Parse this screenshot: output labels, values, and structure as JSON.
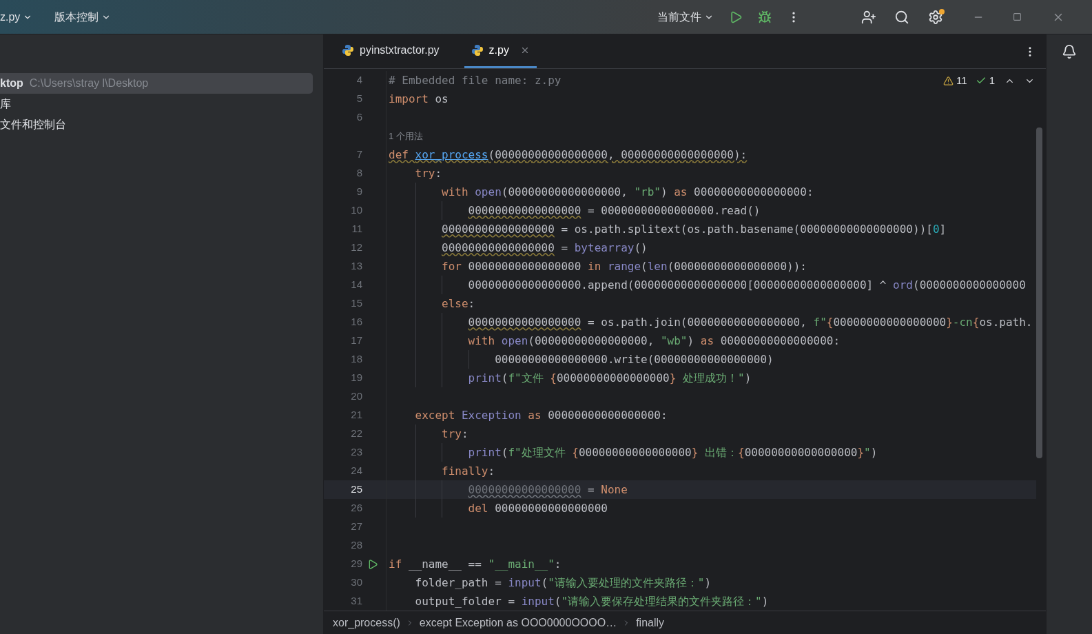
{
  "toolbar": {
    "project": "z.py",
    "vcs": "版本控制",
    "run_config": "当前文件"
  },
  "project_panel": {
    "items": [
      {
        "label": "ktop",
        "path": "C:\\Users\\stray l\\Desktop",
        "selected": true
      },
      {
        "label": "库",
        "selected": false
      },
      {
        "label": "文件和控制台",
        "selected": false
      }
    ]
  },
  "tabs": [
    {
      "label": "pyinstxtractor.py",
      "selected": false
    },
    {
      "label": "z.py",
      "selected": true
    }
  ],
  "inspections": {
    "warnings": "11",
    "passed": "1"
  },
  "lines": [
    {
      "kind": "code",
      "number": "4",
      "current": false,
      "warning": false,
      "run": false,
      "tokens": [
        {
          "kind": "comment",
          "text": "# Embedded file name: z.py"
        }
      ]
    },
    {
      "kind": "code",
      "number": "5",
      "current": false,
      "warning": false,
      "run": false,
      "tokens": [
        {
          "kind": "kw",
          "text": "import"
        },
        {
          "kind": "plain",
          "text": " os"
        }
      ]
    },
    {
      "kind": "code",
      "number": "6",
      "current": false,
      "run": false
    },
    {
      "kind": "hint",
      "text": "1 个用法"
    },
    {
      "kind": "code",
      "number": "7",
      "current": false,
      "warning": true,
      "run": false,
      "tokens": [
        {
          "kind": "kw",
          "text": "def "
        },
        {
          "kind": "fn",
          "text": "xor_process"
        },
        {
          "kind": "plain",
          "text": "(00000000000000000, 00000000000000000):"
        }
      ]
    },
    {
      "kind": "code",
      "number": "8",
      "current": false,
      "warning": false,
      "run": false,
      "tokens": [
        {
          "kind": "kw",
          "text": "    try"
        },
        {
          "kind": "plain",
          "text": ":"
        }
      ]
    },
    {
      "kind": "code",
      "number": "9",
      "current": false,
      "warning": false,
      "run": false,
      "tokens": [
        {
          "kind": "kw",
          "text": "        with "
        },
        {
          "kind": "builtin",
          "text": "open"
        },
        {
          "kind": "plain",
          "text": "(00000000000000000, "
        },
        {
          "kind": "str",
          "text": "\"rb\""
        },
        {
          "kind": "plain",
          "text": ") "
        },
        {
          "kind": "kw",
          "text": "as"
        },
        {
          "kind": "plain",
          "text": " 00000000000000000:"
        }
      ]
    },
    {
      "kind": "code",
      "number": "10",
      "current": false,
      "warning": false,
      "run": false,
      "tokens": [
        {
          "kind": "warn",
          "text": "            00000000000000000"
        },
        {
          "kind": "plain",
          "text": " = 00000000000000000.read()"
        }
      ]
    },
    {
      "kind": "code",
      "number": "11",
      "current": false,
      "warning": false,
      "run": false,
      "tokens": [
        {
          "kind": "warn",
          "text": "        00000000000000000"
        },
        {
          "kind": "plain",
          "text": " = os.path.splitext(os.path.basename(00000000000000000))["
        },
        {
          "kind": "num",
          "text": "0"
        },
        {
          "kind": "plain",
          "text": "]"
        }
      ]
    },
    {
      "kind": "code",
      "number": "12",
      "current": false,
      "warning": false,
      "run": false,
      "tokens": [
        {
          "kind": "warn",
          "text": "        00000000000000000"
        },
        {
          "kind": "plain",
          "text": " = "
        },
        {
          "kind": "builtin",
          "text": "bytearray"
        },
        {
          "kind": "plain",
          "text": "()"
        }
      ]
    },
    {
      "kind": "code",
      "number": "13",
      "current": false,
      "warning": false,
      "run": false,
      "tokens": [
        {
          "kind": "kw",
          "text": "        for"
        },
        {
          "kind": "plain",
          "text": " 00000000000000000 "
        },
        {
          "kind": "kw",
          "text": "in "
        },
        {
          "kind": "builtin",
          "text": "range"
        },
        {
          "kind": "plain",
          "text": "("
        },
        {
          "kind": "builtin",
          "text": "len"
        },
        {
          "kind": "plain",
          "text": "(00000000000000000)):"
        }
      ]
    },
    {
      "kind": "code",
      "number": "14",
      "current": false,
      "warning": false,
      "run": false,
      "tokens": [
        {
          "kind": "plain",
          "text": "            00000000000000000.append(00000000000000000[00000000000000000] ^ "
        },
        {
          "kind": "builtin",
          "text": "ord"
        },
        {
          "kind": "plain",
          "text": "(0000000000000000"
        }
      ]
    },
    {
      "kind": "code",
      "number": "15",
      "current": false,
      "warning": false,
      "run": false,
      "tokens": [
        {
          "kind": "kw",
          "text": "        else"
        },
        {
          "kind": "plain",
          "text": ":"
        }
      ]
    },
    {
      "kind": "code",
      "number": "16",
      "current": false,
      "warning": false,
      "run": false,
      "tokens": [
        {
          "kind": "warn",
          "text": "            00000000000000000"
        },
        {
          "kind": "plain",
          "text": " = os.path.join(00000000000000000, "
        },
        {
          "kind": "str",
          "text": "f\""
        },
        {
          "kind": "kw",
          "text": "{"
        },
        {
          "kind": "plain",
          "text": "00000000000000000"
        },
        {
          "kind": "kw",
          "text": "}"
        },
        {
          "kind": "str",
          "text": "-cn"
        },
        {
          "kind": "kw",
          "text": "{"
        },
        {
          "kind": "plain",
          "text": "os.path."
        }
      ]
    },
    {
      "kind": "code",
      "number": "17",
      "current": false,
      "warning": false,
      "run": false,
      "tokens": [
        {
          "kind": "kw",
          "text": "            with "
        },
        {
          "kind": "builtin",
          "text": "open"
        },
        {
          "kind": "plain",
          "text": "(00000000000000000, "
        },
        {
          "kind": "str",
          "text": "\"wb\""
        },
        {
          "kind": "plain",
          "text": ") "
        },
        {
          "kind": "kw",
          "text": "as"
        },
        {
          "kind": "plain",
          "text": " 00000000000000000:"
        }
      ]
    },
    {
      "kind": "code",
      "number": "18",
      "current": false,
      "warning": false,
      "run": false,
      "tokens": [
        {
          "kind": "plain",
          "text": "                00000000000000000.write(00000000000000000)"
        }
      ]
    },
    {
      "kind": "code",
      "number": "19",
      "current": false,
      "warning": false,
      "run": false,
      "tokens": [
        {
          "kind": "builtin",
          "text": "            print"
        },
        {
          "kind": "plain",
          "text": "("
        },
        {
          "kind": "str",
          "text": "f\"文件 "
        },
        {
          "kind": "kw",
          "text": "{"
        },
        {
          "kind": "plain",
          "text": "00000000000000000"
        },
        {
          "kind": "kw",
          "text": "}"
        },
        {
          "kind": "str",
          "text": " 处理成功！\""
        },
        {
          "kind": "plain",
          "text": ")"
        }
      ]
    },
    {
      "kind": "code",
      "number": "20",
      "current": false,
      "run": false
    },
    {
      "kind": "code",
      "number": "21",
      "current": false,
      "warning": false,
      "run": false,
      "tokens": [
        {
          "kind": "kw",
          "text": "    except "
        },
        {
          "kind": "builtin",
          "text": "Exception"
        },
        {
          "kind": "kw",
          "text": " as"
        },
        {
          "kind": "plain",
          "text": " 00000000000000000:"
        }
      ]
    },
    {
      "kind": "code",
      "number": "22",
      "current": false,
      "warning": false,
      "run": false,
      "tokens": [
        {
          "kind": "kw",
          "text": "        try"
        },
        {
          "kind": "plain",
          "text": ":"
        }
      ]
    },
    {
      "kind": "code",
      "number": "23",
      "current": false,
      "warning": false,
      "run": false,
      "tokens": [
        {
          "kind": "builtin",
          "text": "            print"
        },
        {
          "kind": "plain",
          "text": "("
        },
        {
          "kind": "str",
          "text": "f\"处理文件 "
        },
        {
          "kind": "kw",
          "text": "{"
        },
        {
          "kind": "plain",
          "text": "00000000000000000"
        },
        {
          "kind": "kw",
          "text": "}"
        },
        {
          "kind": "str",
          "text": " 出错："
        },
        {
          "kind": "kw",
          "text": "{"
        },
        {
          "kind": "plain",
          "text": "00000000000000000"
        },
        {
          "kind": "kw",
          "text": "}"
        },
        {
          "kind": "str",
          "text": "\""
        },
        {
          "kind": "plain",
          "text": ")"
        }
      ]
    },
    {
      "kind": "code",
      "number": "24",
      "current": false,
      "warning": false,
      "run": false,
      "tokens": [
        {
          "kind": "kw",
          "text": "        finally"
        },
        {
          "kind": "plain",
          "text": ":"
        }
      ]
    },
    {
      "kind": "code",
      "number": "25",
      "current": true,
      "warning": false,
      "run": false,
      "tokens": [
        {
          "kind": "unused",
          "text": "            00000000000000000"
        },
        {
          "kind": "plain",
          "text": " = "
        },
        {
          "kind": "kw",
          "text": "None"
        }
      ]
    },
    {
      "kind": "code",
      "number": "26",
      "current": false,
      "warning": false,
      "run": false,
      "tokens": [
        {
          "kind": "kw",
          "text": "            del"
        },
        {
          "kind": "plain",
          "text": " 00000000000000000"
        }
      ]
    },
    {
      "kind": "code",
      "number": "27",
      "current": false,
      "run": false
    },
    {
      "kind": "code",
      "number": "28",
      "current": false,
      "run": false
    },
    {
      "kind": "code",
      "number": "29",
      "current": false,
      "warning": false,
      "run": true,
      "tokens": [
        {
          "kind": "kw",
          "text": "if"
        },
        {
          "kind": "plain",
          "text": " __name__ == "
        },
        {
          "kind": "str",
          "text": "\"__main__\""
        },
        {
          "kind": "plain",
          "text": ":"
        }
      ]
    },
    {
      "kind": "code",
      "number": "30",
      "current": false,
      "warning": false,
      "run": false,
      "tokens": [
        {
          "kind": "plain",
          "text": "    folder_path = "
        },
        {
          "kind": "builtin",
          "text": "input"
        },
        {
          "kind": "plain",
          "text": "("
        },
        {
          "kind": "str",
          "text": "\"请输入要处理的文件夹路径：\""
        },
        {
          "kind": "plain",
          "text": ")"
        }
      ]
    },
    {
      "kind": "code",
      "number": "31",
      "current": false,
      "warning": false,
      "run": false,
      "tokens": [
        {
          "kind": "plain",
          "text": "    output_folder = "
        },
        {
          "kind": "builtin",
          "text": "input"
        },
        {
          "kind": "plain",
          "text": "("
        },
        {
          "kind": "str",
          "text": "\"请输入要保存处理结果的文件夹路径：\""
        },
        {
          "kind": "plain",
          "text": ")"
        }
      ]
    }
  ],
  "breadcrumbs": [
    "xor_process()",
    "except Exception as OOO0000OOOO…",
    "finally"
  ]
}
